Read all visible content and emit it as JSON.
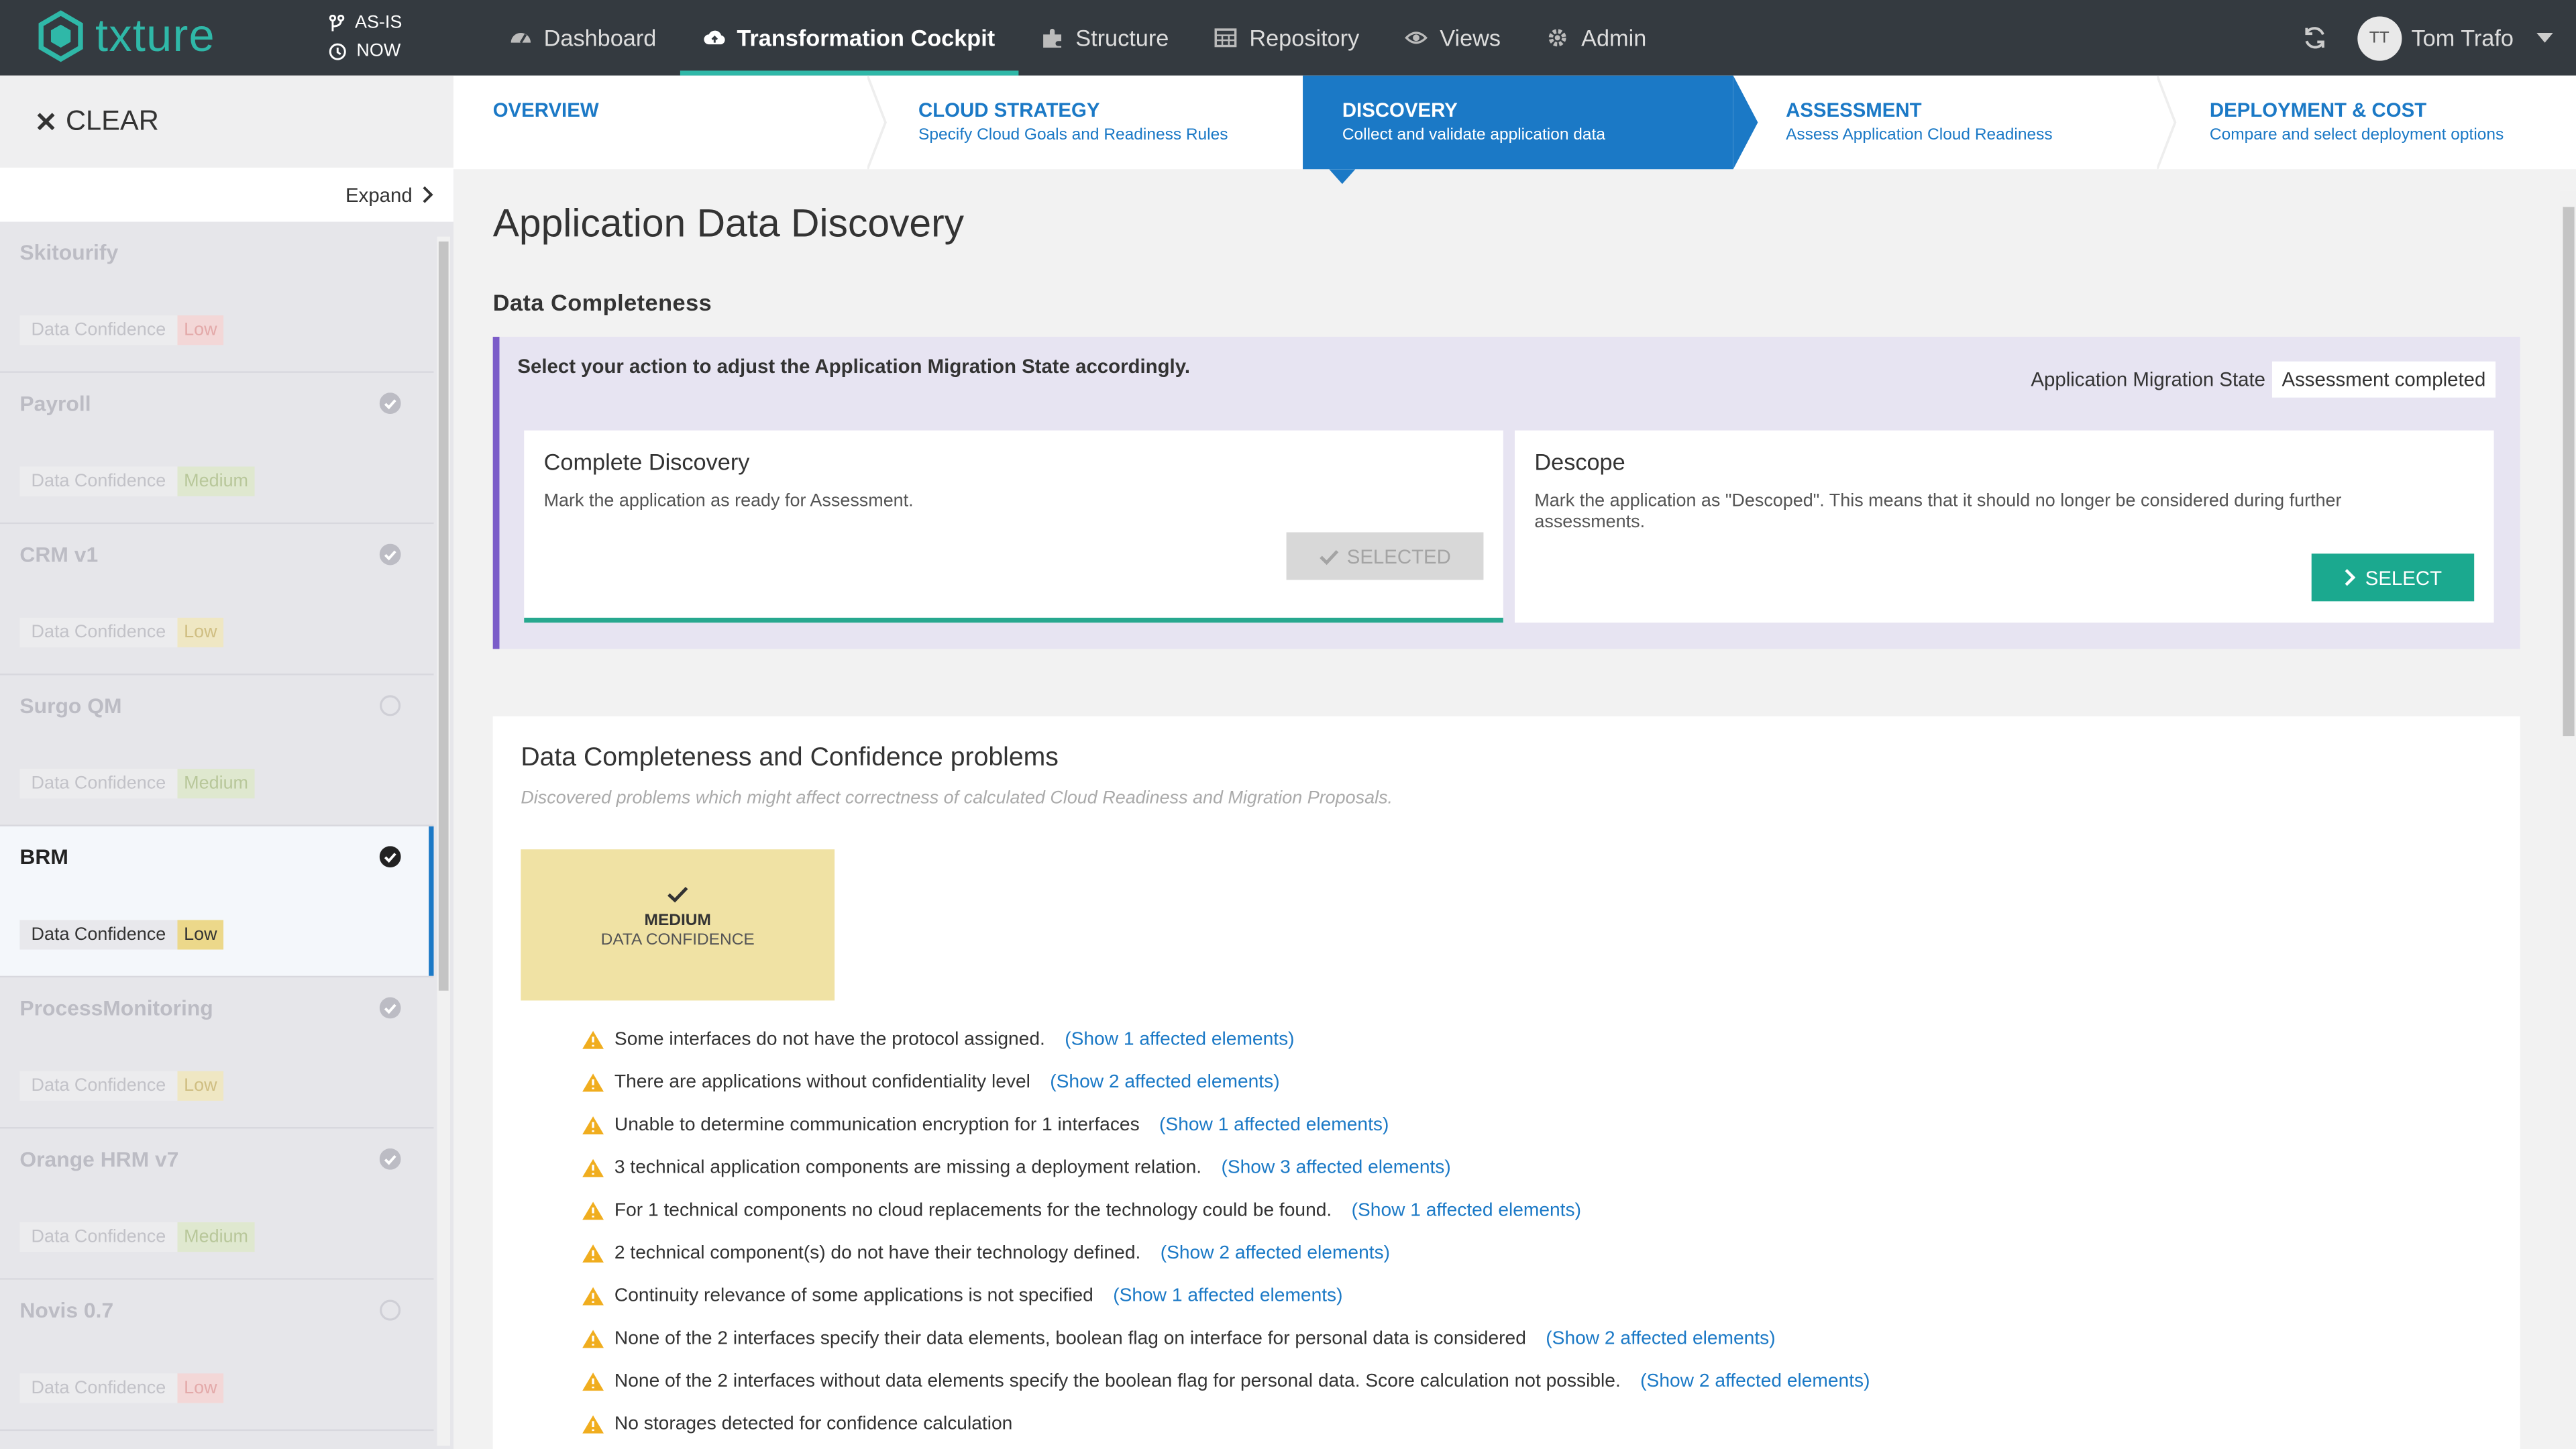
{
  "brand": {
    "name": "txture",
    "color": "#2fb8a8"
  },
  "context": {
    "state": "AS-IS",
    "time": "NOW"
  },
  "nav": [
    {
      "label": "Dashboard",
      "icon": "dashboard-icon",
      "active": false
    },
    {
      "label": "Transformation Cockpit",
      "icon": "cloud-upload-icon",
      "active": true
    },
    {
      "label": "Structure",
      "icon": "puzzle-icon",
      "active": false
    },
    {
      "label": "Repository",
      "icon": "table-icon",
      "active": false
    },
    {
      "label": "Views",
      "icon": "eye-icon",
      "active": false
    },
    {
      "label": "Admin",
      "icon": "gear-icon",
      "active": false
    }
  ],
  "user": {
    "initials": "TT",
    "name": "Tom Trafo"
  },
  "sidebar": {
    "clear_label": "CLEAR",
    "expand_label": "Expand",
    "conf_label": "Data Confidence",
    "apps": [
      {
        "name": "Skitourify",
        "state": "none",
        "confidence": "Low"
      },
      {
        "name": "Payroll",
        "state": "done",
        "confidence": "Medium"
      },
      {
        "name": "CRM v1",
        "state": "done",
        "confidence": "Low"
      },
      {
        "name": "Surgo QM",
        "state": "open",
        "confidence": "Medium"
      },
      {
        "name": "BRM",
        "state": "done",
        "confidence": "Low",
        "selected": true
      },
      {
        "name": "ProcessMonitoring",
        "state": "done",
        "confidence": "Low"
      },
      {
        "name": "Orange HRM v7",
        "state": "done",
        "confidence": "Medium"
      },
      {
        "name": "Novis 0.7",
        "state": "open",
        "confidence": "Low"
      }
    ]
  },
  "steps": [
    {
      "title": "OVERVIEW",
      "subtitle": ""
    },
    {
      "title": "CLOUD STRATEGY",
      "subtitle": "Specify Cloud Goals and Readiness Rules"
    },
    {
      "title": "DISCOVERY",
      "subtitle": "Collect and validate application data",
      "active": true
    },
    {
      "title": "ASSESSMENT",
      "subtitle": "Assess Application Cloud Readiness"
    },
    {
      "title": "DEPLOYMENT & COST",
      "subtitle": "Compare and select deployment options"
    }
  ],
  "page": {
    "title": "Application Data Discovery",
    "section": "Data Completeness"
  },
  "action_panel": {
    "instruction": "Select your action to adjust the Application Migration State accordingly.",
    "state_label": "Application Migration State",
    "state_value": "Assessment completed",
    "complete": {
      "title": "Complete Discovery",
      "desc": "Mark the application as ready for Assessment.",
      "button": "SELECTED"
    },
    "descope": {
      "title": "Descope",
      "desc": "Mark the application as \"Descoped\". This means that it should no longer be considered during further assessments.",
      "button": "SELECT"
    }
  },
  "problems": {
    "title": "Data Completeness and Confidence problems",
    "subtitle": "Discovered problems which might affect correctness of calculated Cloud Readiness and Migration Proposals.",
    "confidence_level": "MEDIUM",
    "confidence_label": "DATA CONFIDENCE",
    "items": [
      {
        "text": "Some interfaces do not have the protocol assigned.",
        "link": "(Show 1 affected elements)"
      },
      {
        "text": "There are applications without confidentiality level",
        "link": "(Show 2 affected elements)"
      },
      {
        "text": "Unable to determine communication encryption for 1 interfaces",
        "link": "(Show 1 affected elements)"
      },
      {
        "text": "3 technical application components are missing a deployment relation.",
        "link": "(Show 3 affected elements)"
      },
      {
        "text": "For 1 technical components no cloud replacements for the technology could be found.",
        "link": "(Show 1 affected elements)"
      },
      {
        "text": "2 technical component(s) do not have their technology defined.",
        "link": "(Show 2 affected elements)"
      },
      {
        "text": "Continuity relevance of some applications is not specified",
        "link": "(Show 1 affected elements)"
      },
      {
        "text": "None of the 2 interfaces specify their data elements, boolean flag on interface for personal data is considered",
        "link": "(Show 2 affected elements)"
      },
      {
        "text": "None of the 2 interfaces without data elements specify the boolean flag for personal data. Score calculation not possible.",
        "link": "(Show 2 affected elements)"
      },
      {
        "text": "No storages detected for confidence calculation",
        "link": ""
      }
    ]
  }
}
